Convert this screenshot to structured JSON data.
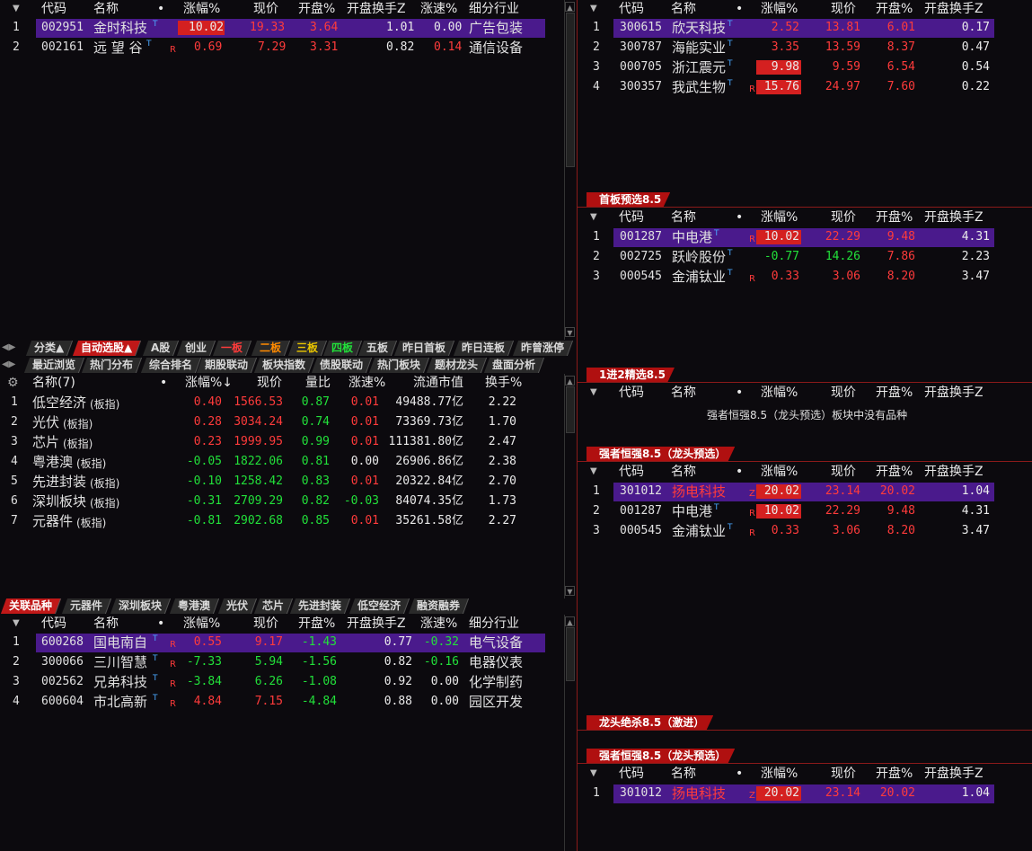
{
  "tl": {
    "headers": [
      "代码",
      "名称",
      "•",
      "涨幅%",
      "现价",
      "开盘%",
      "开盘换手Z",
      "涨速%",
      "细分行业"
    ],
    "rows": [
      {
        "idx": "1",
        "code": "002951",
        "name": "金时科技",
        "flag": "",
        "chg": "10.02",
        "price": "19.33",
        "open": "3.64",
        "to": "1.01",
        "spd": "0.00",
        "ind": "广告包装"
      },
      {
        "idx": "2",
        "code": "002161",
        "name": "远 望 谷",
        "flag": "R",
        "chg": "0.69",
        "price": "7.29",
        "open": "3.31",
        "to": "0.82",
        "spd": "0.14",
        "ind": "通信设备"
      }
    ]
  },
  "tabs1": [
    "分类▲",
    "自动选股▲",
    "A股",
    "创业",
    "一板",
    "二板",
    "三板",
    "四板",
    "五板",
    "昨日首板",
    "昨日连板",
    "昨曾涨停"
  ],
  "tabs2": [
    "最近浏览",
    "热门分布",
    "综合排名",
    "期股联动",
    "板块指数",
    "债股联动",
    "热门板块",
    "题材龙头",
    "盘面分析"
  ],
  "mid": {
    "headers": [
      "名称(7)",
      "•",
      "涨幅%↓",
      "现价",
      "量比",
      "涨速%",
      "流通市值",
      "换手%"
    ],
    "rows": [
      {
        "idx": "1",
        "name": "低空经济",
        "tag": "(板指)",
        "chg": "0.40",
        "price": "1566.53",
        "vr": "0.87",
        "spd": "0.01",
        "cap": "49488.77亿",
        "to": "2.22"
      },
      {
        "idx": "2",
        "name": "光伏",
        "tag": "(板指)",
        "chg": "0.28",
        "price": "3034.24",
        "vr": "0.74",
        "spd": "0.01",
        "cap": "73369.73亿",
        "to": "1.70"
      },
      {
        "idx": "3",
        "name": "芯片",
        "tag": "(板指)",
        "chg": "0.23",
        "price": "1999.95",
        "vr": "0.99",
        "spd": "0.01",
        "cap": "111381.80亿",
        "to": "2.47"
      },
      {
        "idx": "4",
        "name": "粤港澳",
        "tag": "(板指)",
        "chg": "-0.05",
        "price": "1822.06",
        "vr": "0.81",
        "spd": "0.00",
        "cap": "26906.86亿",
        "to": "2.38"
      },
      {
        "idx": "5",
        "name": "先进封装",
        "tag": "(板指)",
        "chg": "-0.10",
        "price": "1258.42",
        "vr": "0.83",
        "spd": "0.01",
        "cap": "20322.84亿",
        "to": "2.70"
      },
      {
        "idx": "6",
        "name": "深圳板块",
        "tag": "(板指)",
        "chg": "-0.31",
        "price": "2709.29",
        "vr": "0.82",
        "spd": "-0.03",
        "cap": "84074.35亿",
        "to": "1.73"
      },
      {
        "idx": "7",
        "name": "元器件",
        "tag": "(板指)",
        "chg": "-0.81",
        "price": "2902.68",
        "vr": "0.85",
        "spd": "0.01",
        "cap": "35261.58亿",
        "to": "2.27"
      }
    ]
  },
  "tabs3": [
    "关联品种",
    "元器件",
    "深圳板块",
    "粤港澳",
    "光伏",
    "芯片",
    "先进封装",
    "低空经济",
    "融资融券"
  ],
  "bl": {
    "headers": [
      "代码",
      "名称",
      "•",
      "涨幅%",
      "现价",
      "开盘%",
      "开盘换手Z",
      "涨速%",
      "细分行业"
    ],
    "rows": [
      {
        "idx": "1",
        "code": "600268",
        "name": "国电南自",
        "flag": "R",
        "chg": "0.55",
        "price": "9.17",
        "open": "-1.43",
        "to": "0.77",
        "spd": "-0.32",
        "ind": "电气设备"
      },
      {
        "idx": "2",
        "code": "300066",
        "name": "三川智慧",
        "flag": "R",
        "chg": "-7.33",
        "price": "5.94",
        "open": "-1.56",
        "to": "0.82",
        "spd": "-0.16",
        "ind": "电器仪表"
      },
      {
        "idx": "3",
        "code": "002562",
        "name": "兄弟科技",
        "flag": "R",
        "chg": "-3.84",
        "price": "6.26",
        "open": "-1.08",
        "to": "0.92",
        "spd": "0.00",
        "ind": "化学制药"
      },
      {
        "idx": "4",
        "code": "600604",
        "name": "市北高新",
        "flag": "R",
        "chg": "4.84",
        "price": "7.15",
        "open": "-4.84",
        "to": "0.88",
        "spd": "0.00",
        "ind": "园区开发"
      }
    ]
  },
  "rhdr": [
    "代码",
    "名称",
    "•",
    "涨幅%",
    "现价",
    "开盘%",
    "开盘换手Z"
  ],
  "r1": {
    "rows": [
      {
        "idx": "1",
        "code": "300615",
        "name": "欣天科技",
        "flag": "",
        "chg": "2.52",
        "price": "13.81",
        "open": "6.01",
        "to": "0.17"
      },
      {
        "idx": "2",
        "code": "300787",
        "name": "海能实业",
        "flag": "",
        "chg": "3.35",
        "price": "13.59",
        "open": "8.37",
        "to": "0.47"
      },
      {
        "idx": "3",
        "code": "000705",
        "name": "浙江震元",
        "flag": "",
        "chg": "9.98",
        "price": "9.59",
        "open": "6.54",
        "to": "0.54"
      },
      {
        "idx": "4",
        "code": "300357",
        "name": "我武生物",
        "flag": "R",
        "chg": "15.76",
        "price": "24.97",
        "open": "7.60",
        "to": "0.22"
      }
    ]
  },
  "r2": {
    "title": "首板预选8.5",
    "rows": [
      {
        "idx": "1",
        "code": "001287",
        "name": "中电港",
        "flag": "R",
        "chg": "10.02",
        "price": "22.29",
        "open": "9.48",
        "to": "4.31"
      },
      {
        "idx": "2",
        "code": "002725",
        "name": "跃岭股份",
        "flag": "",
        "chg": "-0.77",
        "price": "14.26",
        "open": "7.86",
        "to": "2.23"
      },
      {
        "idx": "3",
        "code": "000545",
        "name": "金浦钛业",
        "flag": "R",
        "chg": "0.33",
        "price": "3.06",
        "open": "8.20",
        "to": "3.47"
      }
    ]
  },
  "r3": {
    "title": "1进2精选8.5",
    "empty": "强者恒强8.5（龙头预选）板块中没有品种"
  },
  "r4": {
    "title": "强者恒强8.5（龙头预选）",
    "rows": [
      {
        "idx": "1",
        "code": "301012",
        "name": "扬电科技",
        "flag": "Z",
        "chg": "20.02",
        "price": "23.14",
        "open": "20.02",
        "to": "1.04"
      },
      {
        "idx": "2",
        "code": "001287",
        "name": "中电港",
        "flag": "R",
        "chg": "10.02",
        "price": "22.29",
        "open": "9.48",
        "to": "4.31"
      },
      {
        "idx": "3",
        "code": "000545",
        "name": "金浦钛业",
        "flag": "R",
        "chg": "0.33",
        "price": "3.06",
        "open": "8.20",
        "to": "3.47"
      }
    ]
  },
  "r5": {
    "title": "龙头绝杀8.5（激进）"
  },
  "r6": {
    "title": "强者恒强8.5（龙头预选）",
    "rows": [
      {
        "idx": "1",
        "code": "301012",
        "name": "扬电科技",
        "flag": "Z",
        "chg": "20.02",
        "price": "23.14",
        "open": "20.02",
        "to": "1.04"
      }
    ]
  },
  "colors": {
    "red": "#ff3b3b",
    "green": "#22e03a",
    "highlight": "#4a1a8c",
    "tabActive": "#c01818"
  }
}
